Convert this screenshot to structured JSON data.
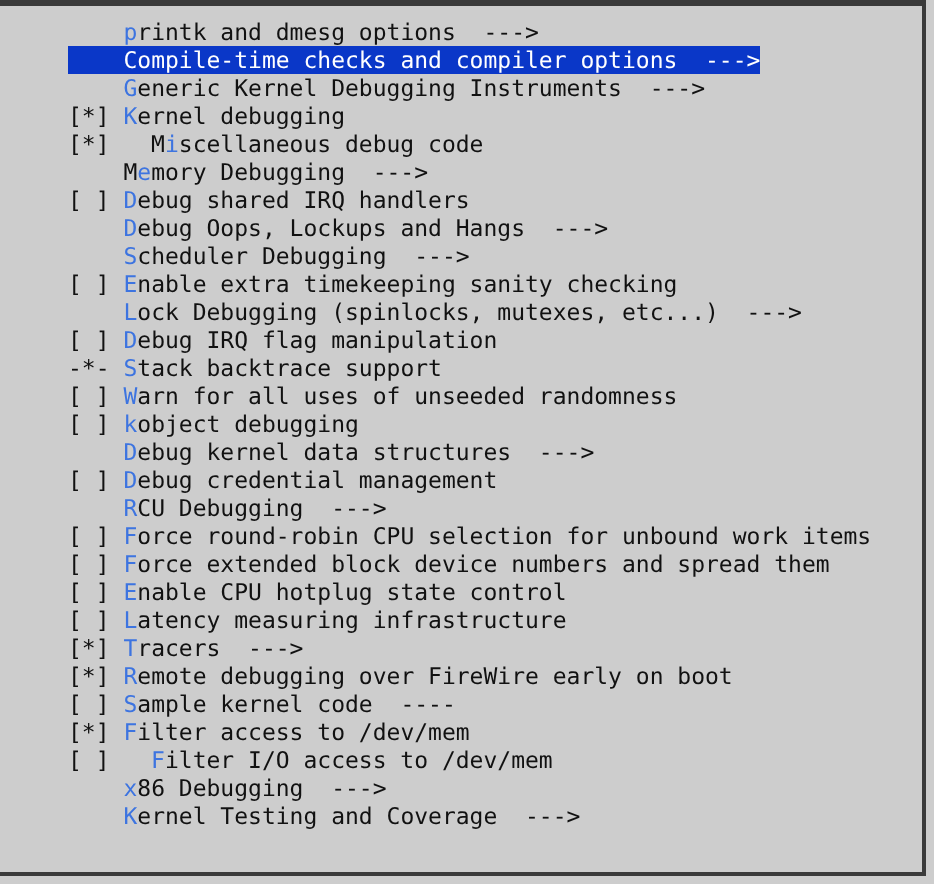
{
  "menu": {
    "items": [
      {
        "hotkey": "p",
        "rest": "rintk and dmesg options",
        "suffix": "--->",
        "selected": false
      },
      {
        "hotkey": "C",
        "rest": "ompile-time checks and compiler options",
        "suffix": "--->",
        "selected": true
      },
      {
        "hotkey": "G",
        "rest": "eneric Kernel Debugging Instruments",
        "suffix": "--->",
        "selected": false
      },
      {
        "prefix": "[*]",
        "hotkey": "K",
        "rest": "ernel debugging",
        "selected": false,
        "children": [
          {
            "prefix": "[*]",
            "lead": "M",
            "hotkey": "i",
            "rest": "scellaneous debug code",
            "selected": false
          }
        ]
      },
      {
        "lead": "M",
        "hotkey": "e",
        "rest": "mory Debugging",
        "suffix": "--->",
        "selected": false
      },
      {
        "prefix": "[ ]",
        "hotkey": "D",
        "rest": "ebug shared IRQ handlers",
        "selected": false
      },
      {
        "hotkey": "D",
        "rest": "ebug Oops, Lockups and Hangs",
        "suffix": "--->",
        "selected": false
      },
      {
        "hotkey": "S",
        "rest": "cheduler Debugging",
        "suffix": "--->",
        "selected": false
      },
      {
        "prefix": "[ ]",
        "hotkey": "E",
        "rest": "nable extra timekeeping sanity checking",
        "selected": false
      },
      {
        "hotkey": "L",
        "rest": "ock Debugging (spinlocks, mutexes, etc...)",
        "suffix": "--->",
        "selected": false
      },
      {
        "prefix": "[ ]",
        "hotkey": "D",
        "rest": "ebug IRQ flag manipulation",
        "selected": false
      },
      {
        "prefix": "-*-",
        "hotkey": "S",
        "rest": "tack backtrace support",
        "selected": false
      },
      {
        "prefix": "[ ]",
        "hotkey": "W",
        "rest": "arn for all uses of unseeded randomness",
        "selected": false
      },
      {
        "prefix": "[ ]",
        "hotkey": "k",
        "rest": "object debugging",
        "selected": false
      },
      {
        "hotkey": "D",
        "rest": "ebug kernel data structures",
        "suffix": "--->",
        "selected": false
      },
      {
        "prefix": "[ ]",
        "hotkey": "D",
        "rest": "ebug credential management",
        "selected": false
      },
      {
        "hotkey": "R",
        "rest": "CU Debugging",
        "suffix": "--->",
        "selected": false
      },
      {
        "prefix": "[ ]",
        "hotkey": "F",
        "rest": "orce round-robin CPU selection for unbound work items",
        "selected": false
      },
      {
        "prefix": "[ ]",
        "hotkey": "F",
        "rest": "orce extended block device numbers and spread them",
        "selected": false
      },
      {
        "prefix": "[ ]",
        "hotkey": "E",
        "rest": "nable CPU hotplug state control",
        "selected": false
      },
      {
        "prefix": "[ ]",
        "hotkey": "L",
        "rest": "atency measuring infrastructure",
        "selected": false
      },
      {
        "prefix": "[*]",
        "hotkey": "T",
        "rest": "racers",
        "suffix": "--->",
        "selected": false
      },
      {
        "prefix": "[*]",
        "hotkey": "R",
        "rest": "emote debugging over FireWire early on boot",
        "selected": false
      },
      {
        "prefix": "[ ]",
        "hotkey": "S",
        "rest": "ample kernel code",
        "suffix": "----",
        "selected": false
      },
      {
        "prefix": "[*]",
        "hotkey": "F",
        "rest": "ilter access to /dev/mem",
        "selected": false,
        "children": [
          {
            "prefix": "[ ]",
            "hotkey": "F",
            "rest": "ilter I/O access to /dev/mem",
            "selected": false
          }
        ]
      },
      {
        "hotkey": "x",
        "rest": "86 Debugging",
        "suffix": "--->",
        "selected": false
      },
      {
        "hotkey": "K",
        "rest": "ernel Testing and Coverage",
        "suffix": "--->",
        "selected": false
      }
    ]
  }
}
